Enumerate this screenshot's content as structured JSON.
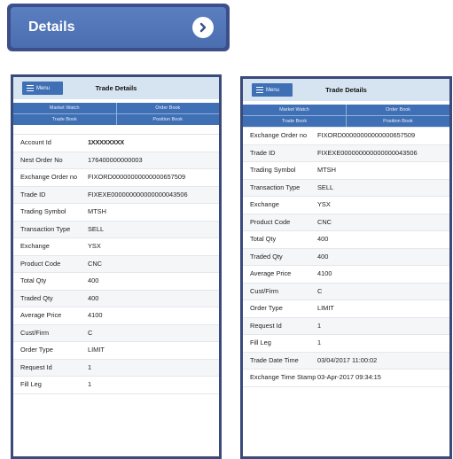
{
  "details_button": {
    "label": "Details"
  },
  "screens": {
    "left": {
      "menu_label": "Menu",
      "title": "Trade Details",
      "tabs": [
        "Market Watch",
        "Order Book",
        "Trade Book",
        "Position Book"
      ],
      "rows": [
        {
          "label": "Account Id",
          "value": "1XXXXXXXX"
        },
        {
          "label": "Nest Order No",
          "value": "176400000000003"
        },
        {
          "label": "Exchange Order no",
          "value": "FIXORD00000000000000657509"
        },
        {
          "label": "Trade ID",
          "value": "FIXEXE000000000000000043506"
        },
        {
          "label": "Trading Symbol",
          "value": "MTSH"
        },
        {
          "label": "Transaction Type",
          "value": "SELL"
        },
        {
          "label": "Exchange",
          "value": "YSX"
        },
        {
          "label": "Product Code",
          "value": "CNC"
        },
        {
          "label": "Total Qty",
          "value": "400"
        },
        {
          "label": "Traded Qty",
          "value": "400"
        },
        {
          "label": "Average Price",
          "value": "4100"
        },
        {
          "label": "Cust/Firm",
          "value": "C"
        },
        {
          "label": "Order Type",
          "value": "LIMIT"
        },
        {
          "label": "Request Id",
          "value": "1"
        },
        {
          "label": "Fill Leg",
          "value": "1"
        }
      ]
    },
    "right": {
      "menu_label": "Menu",
      "title": "Trade Details",
      "tabs": [
        "Market Watch",
        "Order Book",
        "Trade Book",
        "Position Book"
      ],
      "rows": [
        {
          "label": "Exchange Order no",
          "value": "FIXORD00000000000000657509"
        },
        {
          "label": "Trade ID",
          "value": "FIXEXE000000000000000043506"
        },
        {
          "label": "Trading Symbol",
          "value": "MTSH"
        },
        {
          "label": "Transaction Type",
          "value": "SELL"
        },
        {
          "label": "Exchange",
          "value": "YSX"
        },
        {
          "label": "Product Code",
          "value": "CNC"
        },
        {
          "label": "Total Qty",
          "value": "400"
        },
        {
          "label": "Traded Qty",
          "value": "400"
        },
        {
          "label": "Average Price",
          "value": "4100"
        },
        {
          "label": "Cust/Firm",
          "value": "C"
        },
        {
          "label": "Order Type",
          "value": "LIMIT"
        },
        {
          "label": "Request Id",
          "value": "1"
        },
        {
          "label": "Fill Leg",
          "value": "1"
        },
        {
          "label": "Trade Date Time",
          "value": "03/04/2017 11:00:02"
        },
        {
          "label": "Exchange Time Stamp",
          "value": "03-Apr-2017 09:34:15"
        }
      ]
    }
  },
  "colors": {
    "primary": "#3f6fb4",
    "title_bar": "#d6e4f1",
    "frame": "#3a4a7a"
  }
}
